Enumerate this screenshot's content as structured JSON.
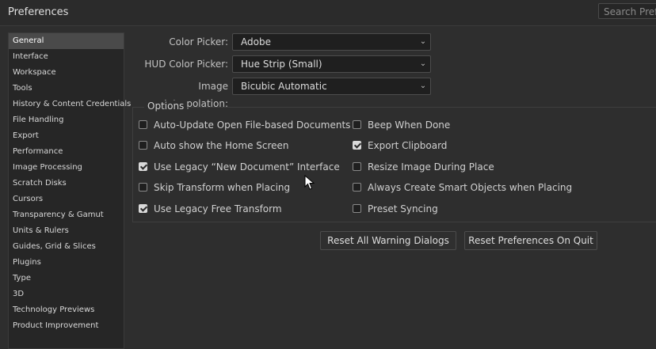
{
  "window": {
    "title": "Preferences",
    "search_placeholder": "Search Prefe"
  },
  "sidebar": {
    "items": [
      {
        "label": "General",
        "selected": true
      },
      {
        "label": "Interface"
      },
      {
        "label": "Workspace"
      },
      {
        "label": "Tools"
      },
      {
        "label": "History & Content Credentials"
      },
      {
        "label": "File Handling"
      },
      {
        "label": "Export"
      },
      {
        "label": "Performance"
      },
      {
        "label": "Image Processing"
      },
      {
        "label": "Scratch Disks"
      },
      {
        "label": "Cursors"
      },
      {
        "label": "Transparency & Gamut"
      },
      {
        "label": "Units & Rulers"
      },
      {
        "label": "Guides, Grid & Slices"
      },
      {
        "label": "Plugins"
      },
      {
        "label": "Type"
      },
      {
        "label": "3D"
      },
      {
        "label": "Technology Previews"
      },
      {
        "label": "Product Improvement"
      }
    ]
  },
  "general": {
    "color_picker": {
      "label": "Color Picker:",
      "value": "Adobe"
    },
    "hud_color_picker": {
      "label": "HUD Color Picker:",
      "value": "Hue Strip (Small)"
    },
    "image_interpolation": {
      "label": "Image Interpolation:",
      "value": "Bicubic Automatic"
    }
  },
  "options": {
    "legend": "Options",
    "left": [
      {
        "label": "Auto-Update Open File-based Documents",
        "checked": false
      },
      {
        "label": "Auto show the Home Screen",
        "checked": false
      },
      {
        "label": "Use Legacy “New Document” Interface",
        "checked": true
      },
      {
        "label": "Skip Transform when Placing",
        "checked": false
      },
      {
        "label": "Use Legacy Free Transform",
        "checked": true
      }
    ],
    "right": [
      {
        "label": "Beep When Done",
        "checked": false
      },
      {
        "label": "Export Clipboard",
        "checked": true
      },
      {
        "label": "Resize Image During Place",
        "checked": false
      },
      {
        "label": "Always Create Smart Objects when Placing",
        "checked": false
      },
      {
        "label": "Preset Syncing",
        "checked": false
      }
    ]
  },
  "buttons": {
    "reset_warnings": "Reset All Warning Dialogs",
    "reset_prefs": "Reset Preferences On Quit"
  },
  "icons": {
    "dropdown": "chevron-down-icon",
    "cursor": "mouse-pointer-icon",
    "checkbox": "check-icon"
  },
  "colors": {
    "background": "#2e2e2e",
    "panel": "#262626",
    "selected": "#4a4a4a",
    "text": "#c8c8c8"
  }
}
